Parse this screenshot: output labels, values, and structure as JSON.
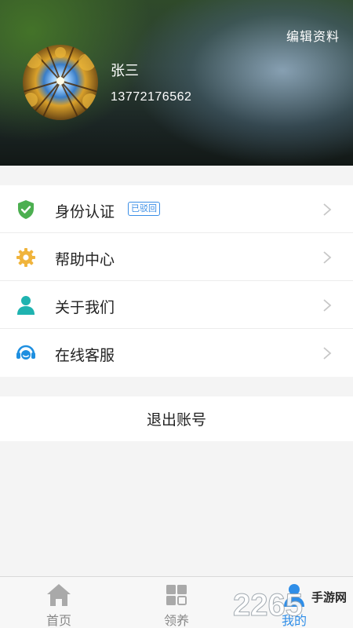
{
  "header": {
    "edit_label": "编辑资料",
    "user_name": "张三",
    "user_phone": "13772176562"
  },
  "menu": [
    {
      "label": "身份认证",
      "badge": "已驳回",
      "icon": "shield-check-icon",
      "icon_color": "#4caf50"
    },
    {
      "label": "帮助中心",
      "icon": "gear-icon",
      "icon_color": "#f0b43c"
    },
    {
      "label": "关于我们",
      "icon": "person-icon",
      "icon_color": "#1fb3b0"
    },
    {
      "label": "在线客服",
      "icon": "headset-icon",
      "icon_color": "#1e8fe0"
    }
  ],
  "logout_label": "退出账号",
  "tabs": [
    {
      "label": "首页",
      "icon": "home-icon"
    },
    {
      "label": "领养",
      "icon": "grid-icon"
    },
    {
      "label": "我的",
      "icon": "user-icon",
      "active": true
    }
  ],
  "watermark": {
    "number": "2265",
    "text": "手游网"
  },
  "colors": {
    "accent": "#2f8ee8",
    "badge": "#3a8ee6"
  }
}
